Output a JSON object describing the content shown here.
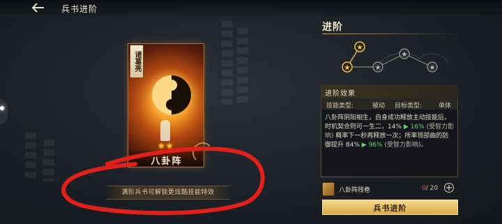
{
  "header": {
    "back_icon": "arrow-left-icon",
    "title": "兵书进阶"
  },
  "card": {
    "general_name": "诸葛亮",
    "stars": "★★",
    "title": "八卦阵"
  },
  "hint": {
    "text": "满阶兵书可解锁更炫酷技能特效"
  },
  "upgrade": {
    "heading": "进阶",
    "star_nodes": [
      {
        "state": "active"
      },
      {
        "state": "active"
      },
      {
        "state": "locked"
      },
      {
        "state": "locked"
      },
      {
        "state": "locked"
      }
    ],
    "effect": {
      "title": "进阶效果",
      "skill_type_label": "技能类型:",
      "skill_type_value": "被动",
      "target_type_label": "目标类型:",
      "target_type_value": "单体",
      "desc_intro": "八卦阵阴阳相生，自身成功释放主动技能后，时机契合则可一生二，",
      "desc_v1_from": "14%",
      "desc_arrow": "▶",
      "desc_v1_to": "16%",
      "desc_v1_note": "(受智力影响)",
      "desc_mid": "概率下一秒再释放一次；所率领部曲的防御提升",
      "desc_v2_from": "84%",
      "desc_v2_to": "96%",
      "desc_v2_note": "(受智力影响)。"
    },
    "material": {
      "icon": "scroll-icon",
      "name": "八卦阵残卷",
      "have": "0",
      "need": "/ 20",
      "add_icon": "plus-icon"
    },
    "button_label": "兵书进阶"
  },
  "colors": {
    "accent_gold": "#d9ab47",
    "annotation_red": "#e0201a",
    "buff_green": "#5fd76a"
  }
}
